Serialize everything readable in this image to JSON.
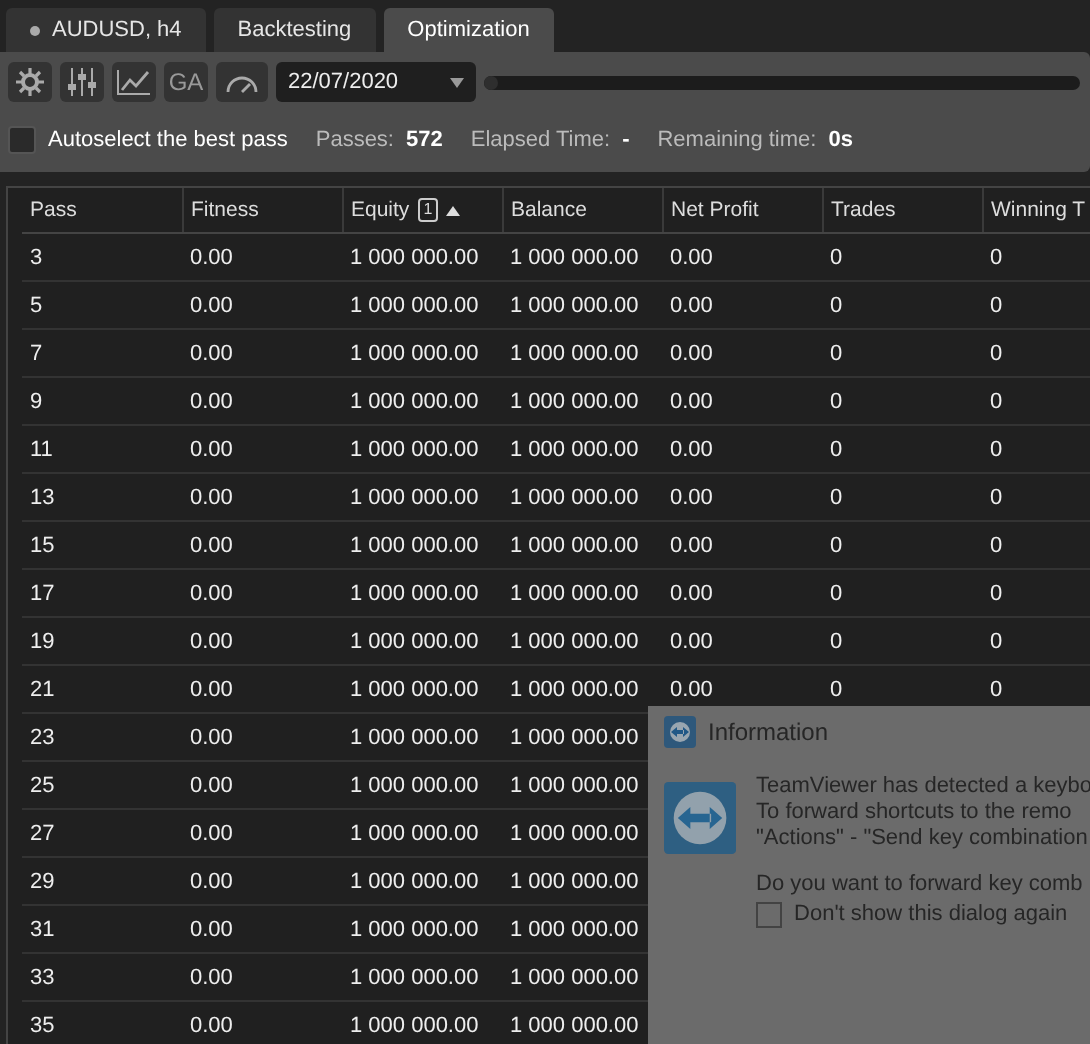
{
  "tabs": [
    {
      "label": "AUDUSD, h4",
      "kind": "chart",
      "selected": false
    },
    {
      "label": "Backtesting",
      "kind": "plain",
      "selected": false
    },
    {
      "label": "Optimization",
      "kind": "plain",
      "selected": true
    }
  ],
  "toolbar": {
    "ga_label": "GA",
    "date": "22/07/2020",
    "progress": {
      "level": 0
    }
  },
  "status": {
    "autoselect": {
      "label": "Autoselect the best pass",
      "checked": false
    },
    "passes_label": "Passes:",
    "passes": "572",
    "elapsed_label": "Elapsed Time:",
    "elapsed": "-",
    "remaining_label": "Remaining time:",
    "remaining": "0s"
  },
  "table": {
    "columns": [
      {
        "label": "Pass"
      },
      {
        "label": "Fitness"
      },
      {
        "label": "Equity",
        "sort_index": "1",
        "sorted": true
      },
      {
        "label": "Balance"
      },
      {
        "label": "Net Profit"
      },
      {
        "label": "Trades"
      },
      {
        "label": "Winning T"
      }
    ],
    "rows": [
      [
        "3",
        "0.00",
        "1 000 000.00",
        "1 000 000.00",
        "0.00",
        "0",
        "0"
      ],
      [
        "5",
        "0.00",
        "1 000 000.00",
        "1 000 000.00",
        "0.00",
        "0",
        "0"
      ],
      [
        "7",
        "0.00",
        "1 000 000.00",
        "1 000 000.00",
        "0.00",
        "0",
        "0"
      ],
      [
        "9",
        "0.00",
        "1 000 000.00",
        "1 000 000.00",
        "0.00",
        "0",
        "0"
      ],
      [
        "11",
        "0.00",
        "1 000 000.00",
        "1 000 000.00",
        "0.00",
        "0",
        "0"
      ],
      [
        "13",
        "0.00",
        "1 000 000.00",
        "1 000 000.00",
        "0.00",
        "0",
        "0"
      ],
      [
        "15",
        "0.00",
        "1 000 000.00",
        "1 000 000.00",
        "0.00",
        "0",
        "0"
      ],
      [
        "17",
        "0.00",
        "1 000 000.00",
        "1 000 000.00",
        "0.00",
        "0",
        "0"
      ],
      [
        "19",
        "0.00",
        "1 000 000.00",
        "1 000 000.00",
        "0.00",
        "0",
        "0"
      ],
      [
        "21",
        "0.00",
        "1 000 000.00",
        "1 000 000.00",
        "0.00",
        "0",
        "0"
      ],
      [
        "23",
        "0.00",
        "1 000 000.00",
        "1 000 000.00"
      ],
      [
        "25",
        "0.00",
        "1 000 000.00",
        "1 000 000.00"
      ],
      [
        "27",
        "0.00",
        "1 000 000.00",
        "1 000 000.00"
      ],
      [
        "29",
        "0.00",
        "1 000 000.00",
        "1 000 000.00"
      ],
      [
        "31",
        "0.00",
        "1 000 000.00",
        "1 000 000.00"
      ],
      [
        "33",
        "0.00",
        "1 000 000.00",
        "1 000 000.00"
      ],
      [
        "35",
        "0.00",
        "1 000 000.00",
        "1 000 000.00"
      ]
    ]
  },
  "dialog": {
    "title": "Information",
    "lines": [
      "TeamViewer has detected a keybo",
      "To forward shortcuts to the remo",
      "\"Actions\" - \"Send key combination"
    ],
    "question": "Do you want to forward key comb",
    "dont_show": {
      "label": "Don't show this dialog again",
      "checked": false
    }
  }
}
